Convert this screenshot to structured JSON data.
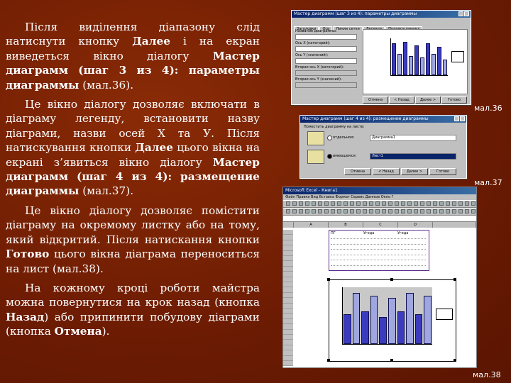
{
  "paragraphs": [
    {
      "t1": "Після виділення діапазону слід натиснути кнопку ",
      "b1": "Далее",
      "t2": " і на екран виведеться вікно діалогу ",
      "b2": "Мастер диаграмм (шаг 3 из 4): параметры диаграммы",
      "t3": " (мал.36)."
    },
    {
      "t1": "Це вікно діалогу дозволяє включати в діаграму легенду, встановити назву діаграми, назви осей Х та У. Після натискування кнопки ",
      "b1": "Далее",
      "t2": " цього вікна на екрані з’явиться вікно діалогу ",
      "b2": "Мастер диаграмм (шаг 4 из 4): размещение диаграммы",
      "t3": " (мал.37)."
    },
    {
      "t1": "Це вікно діалогу дозволяє помістити діаграму на окремому листку або на тому, який відкритий. Після натискання кнопки ",
      "b1": "Готово",
      "t2": " цього вікна діаграма переноситься на лист (мал.38).",
      "b2": "",
      "t3": ""
    },
    {
      "t1": "На кожному кроці роботи майстра можна повернутися на крок назад (кнопка ",
      "b1": "Назад",
      "t2": ") або припинити побудову діаграми (кнопка ",
      "b2": "Отмена",
      "t3": ")."
    }
  ],
  "captions": {
    "fig36": "мал.36",
    "fig37": "мал.37",
    "fig38": "мал.38"
  },
  "fig36": {
    "title": "Мастер диаграмм (шаг 3 из 4): параметры диаграммы",
    "tabs": [
      "Заголовки",
      "Оси",
      "Линии сетки",
      "Легенда",
      "Подписи данных",
      "Таблица данных"
    ],
    "field_labels": [
      "Название диаграммы:",
      "Ось X (категорий):",
      "Ось Y (значений):",
      "Вторая ось X (категорий):",
      "Вторая ось Y (значений):"
    ],
    "buttons": [
      "Отмена",
      "< Назад",
      "Далее >",
      "Готово"
    ],
    "chart_values": [
      0.9,
      0.6,
      0.95,
      0.55,
      0.85,
      0.5,
      0.9,
      0.6,
      0.8,
      0.45
    ]
  },
  "fig37": {
    "title": "Мастер диаграмм (шаг 4 из 4): размещение диаграммы",
    "heading": "Поместить диаграмму на листе:",
    "option1": "отдельном:",
    "option1_value": "Диаграмма1",
    "option2": "имеющемся:",
    "option2_value": "Лист1",
    "buttons": [
      "Отмена",
      "< Назад",
      "Далее >",
      "Готово"
    ]
  },
  "fig38": {
    "title": "Microsoft Excel - Книга1",
    "menu": "Файл Правка Вид Вставка Формат Сервис Данные Окно ?",
    "columns": [
      "A",
      "B",
      "C",
      "D"
    ],
    "headers": [
      "ПГ",
      "Угода",
      "Угода"
    ],
    "chart_values": [
      0.55,
      0.95,
      0.6,
      0.9,
      0.5,
      0.85,
      0.6,
      0.95,
      0.55,
      0.9
    ]
  }
}
